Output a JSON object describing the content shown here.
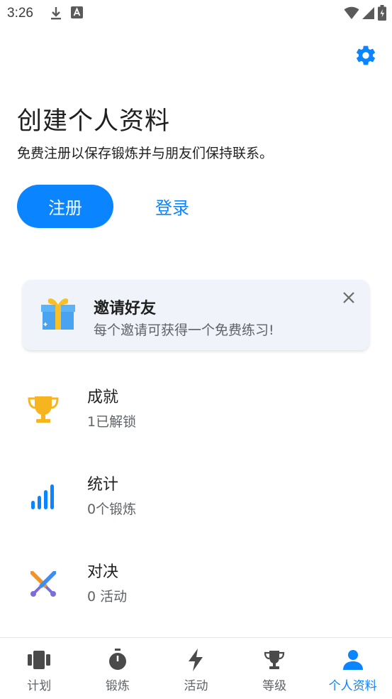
{
  "status_bar": {
    "time": "3:26",
    "icons": [
      "download-icon",
      "text-a-icon",
      "wifi-icon",
      "signal-icon",
      "battery-icon"
    ]
  },
  "header": {
    "settings_icon": "gear-icon"
  },
  "profile": {
    "title": "创建个人资料",
    "subtitle": "免费注册以保存锻炼并与朋友们保持联系。",
    "register_label": "注册",
    "login_label": "登录"
  },
  "invite": {
    "title": "邀请好友",
    "text": "每个邀请可获得一个免费练习!",
    "icon": "gift-icon"
  },
  "stats": [
    {
      "title": "成就",
      "sub": "1已解锁",
      "icon": "trophy-icon"
    },
    {
      "title": "统计",
      "sub": "0个锻炼",
      "icon": "bar-chart-icon"
    },
    {
      "title": "对决",
      "sub": "0 活动",
      "icon": "crossed-swords-icon"
    }
  ],
  "nav": {
    "items": [
      {
        "label": "计划",
        "icon": "plan-icon"
      },
      {
        "label": "锻炼",
        "icon": "stopwatch-icon"
      },
      {
        "label": "活动",
        "icon": "lightning-icon"
      },
      {
        "label": "等级",
        "icon": "trophy-icon"
      },
      {
        "label": "个人资料",
        "icon": "person-icon"
      }
    ],
    "active": "个人资料"
  },
  "colors": {
    "accent": "#0a84ff",
    "card_bg": "#f0f4fa",
    "text_primary": "#1f1f1f",
    "text_secondary": "#5f6368",
    "nav_inactive": "#4a4a4a"
  }
}
